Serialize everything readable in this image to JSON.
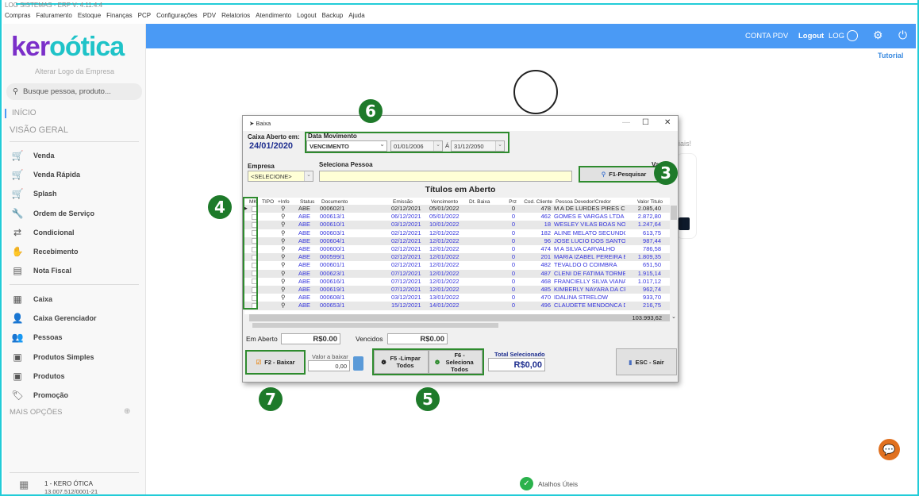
{
  "window": {
    "title": "LOG SISTEMAS - ERP V: 4.11.4.4"
  },
  "menu": [
    "Compras",
    "Faturamento",
    "Estoque",
    "Finanças",
    "PCP",
    "Configurações",
    "PDV",
    "Relatorios",
    "Atendimento",
    "Logout",
    "Backup",
    "Ajuda"
  ],
  "sidebar": {
    "logo": "keroótica",
    "change_logo": "Alterar Logo da Empresa",
    "search_placeholder": "Busque pessoa, produto...",
    "inicio": "INÍCIO",
    "visao": "VISÃO GERAL",
    "group1": [
      {
        "label": "Venda",
        "icon": "cart-icon"
      },
      {
        "label": "Venda Rápida",
        "icon": "cart-fast-icon"
      },
      {
        "label": "Splash",
        "icon": "cart-money-icon"
      },
      {
        "label": "Ordem de Serviço",
        "icon": "wrench-icon"
      },
      {
        "label": "Condicional",
        "icon": "cart-exchange-icon"
      },
      {
        "label": "Recebimento",
        "icon": "hand-money-icon"
      },
      {
        "label": "Nota Fiscal",
        "icon": "nfe-icon"
      }
    ],
    "group2": [
      {
        "label": "Caixa",
        "icon": "cash-register-icon"
      },
      {
        "label": "Caixa Gerenciador",
        "icon": "user-money-icon"
      },
      {
        "label": "Pessoas",
        "icon": "user-list-icon"
      },
      {
        "label": "Produtos Simples",
        "icon": "box-icon"
      },
      {
        "label": "Produtos",
        "icon": "box-icon"
      },
      {
        "label": "Promoção",
        "icon": "tag-icon"
      }
    ],
    "more": "MAIS OPÇÕES",
    "company": "1 - KERO ÓTICA",
    "cnpj": "13.007.512/0001-21"
  },
  "header": {
    "conta": "CONTA PDV",
    "logout": "Logout",
    "user": "LOG",
    "tutorial": "Tutorial"
  },
  "background": {
    "partial_text": "iais!",
    "shortcuts": "Atalhos Úteis"
  },
  "dialog": {
    "title": "Baixa",
    "caixa_label": "Caixa Aberto em:",
    "caixa_date": "24/01/2020",
    "data_mov_label": "Data Movimento",
    "data_mov_type": "VENCIMENTO",
    "date_from": "01/01/2006",
    "date_sep": "Á",
    "date_to": "31/12/2050",
    "empresa_label": "Empresa",
    "empresa_value": "<SELECIONE>",
    "pessoa_label": "Seleciona Pessoa",
    "pessoa_value": "",
    "search_button": "F1-Pesquisar",
    "partial_label": "Va",
    "grid_title": "Títulos em Aberto",
    "columns": [
      "MK",
      "TIPO",
      "+Info",
      "Status",
      "Documento",
      "Emissão",
      "Vencimento",
      "Dt. Baixa",
      "Prz",
      "Cod. Cliente",
      "Pessoa Devedor/Credor",
      "Valor Titulo"
    ],
    "rows": [
      [
        "ABE",
        "000602/1",
        "02/12/2021",
        "05/01/2022",
        "0",
        "478",
        "M A DE LURDES PIRES CO",
        "2.085,40"
      ],
      [
        "ABE",
        "000613/1",
        "06/12/2021",
        "05/01/2022",
        "0",
        "462",
        "GOMES E VARGAS LTDA M",
        "2.872,80"
      ],
      [
        "ABE",
        "000610/1",
        "03/12/2021",
        "10/01/2022",
        "0",
        "18",
        "WESLEY VILAS BOAS NOG",
        "1.247,64"
      ],
      [
        "ABE",
        "000603/1",
        "02/12/2021",
        "12/01/2022",
        "0",
        "182",
        "ALINE MELATO SECUNDO",
        "613,75"
      ],
      [
        "ABE",
        "000604/1",
        "02/12/2021",
        "12/01/2022",
        "0",
        "96",
        "JOSE LUCIO DOS SANTOS",
        "987,44"
      ],
      [
        "ABE",
        "000600/1",
        "02/12/2021",
        "12/01/2022",
        "0",
        "474",
        "M A SILVA CARVALHO",
        "786,58"
      ],
      [
        "ABE",
        "000599/1",
        "02/12/2021",
        "12/01/2022",
        "0",
        "201",
        "MARIA IZABEL PEREIRA El",
        "1.809,35"
      ],
      [
        "ABE",
        "000601/1",
        "02/12/2021",
        "12/01/2022",
        "0",
        "482",
        "TEVALDO O COIMBRA",
        "651,50"
      ],
      [
        "ABE",
        "000623/1",
        "07/12/2021",
        "12/01/2022",
        "0",
        "487",
        "CLENI DE FATIMA TORME",
        "1.915,14"
      ],
      [
        "ABE",
        "000616/1",
        "07/12/2021",
        "12/01/2022",
        "0",
        "468",
        "FRANCIELLY SILVA VIANA",
        "1.017,12"
      ],
      [
        "ABE",
        "000619/1",
        "07/12/2021",
        "12/01/2022",
        "0",
        "485",
        "KIMBERLY  NAYARA DA CF",
        "962,74"
      ],
      [
        "ABE",
        "000608/1",
        "03/12/2021",
        "13/01/2022",
        "0",
        "470",
        "IDALINA STRELOW",
        "933,70"
      ],
      [
        "ABE",
        "000653/1",
        "15/12/2021",
        "14/01/2022",
        "0",
        "496",
        "CLAUDETE MENDONCA DE",
        "216,75"
      ]
    ],
    "total": "103.993,62",
    "em_aberto_label": "Em Aberto",
    "em_aberto": "R$0.00",
    "vencidos_label": "Vencidos",
    "vencidos": "R$0.00",
    "baixar": "F2 - Baixar",
    "valor_label": "Valor a baixar",
    "valor": "0,00",
    "limpar": "F5 -Limpar Todos",
    "seleciona": "F6 - Seleciona Todos",
    "total_sel_label": "Total Selecionado",
    "total_sel": "R$0,00",
    "sair": "ESC - Sair"
  },
  "markers": [
    "6",
    "3",
    "4",
    "7",
    "5"
  ],
  "colors": {
    "header": "#4a9af5",
    "marker": "#1e7a2a",
    "highlight": "#2e8b2e",
    "link_row": "#3333dd",
    "frame": "#22ccd8"
  }
}
